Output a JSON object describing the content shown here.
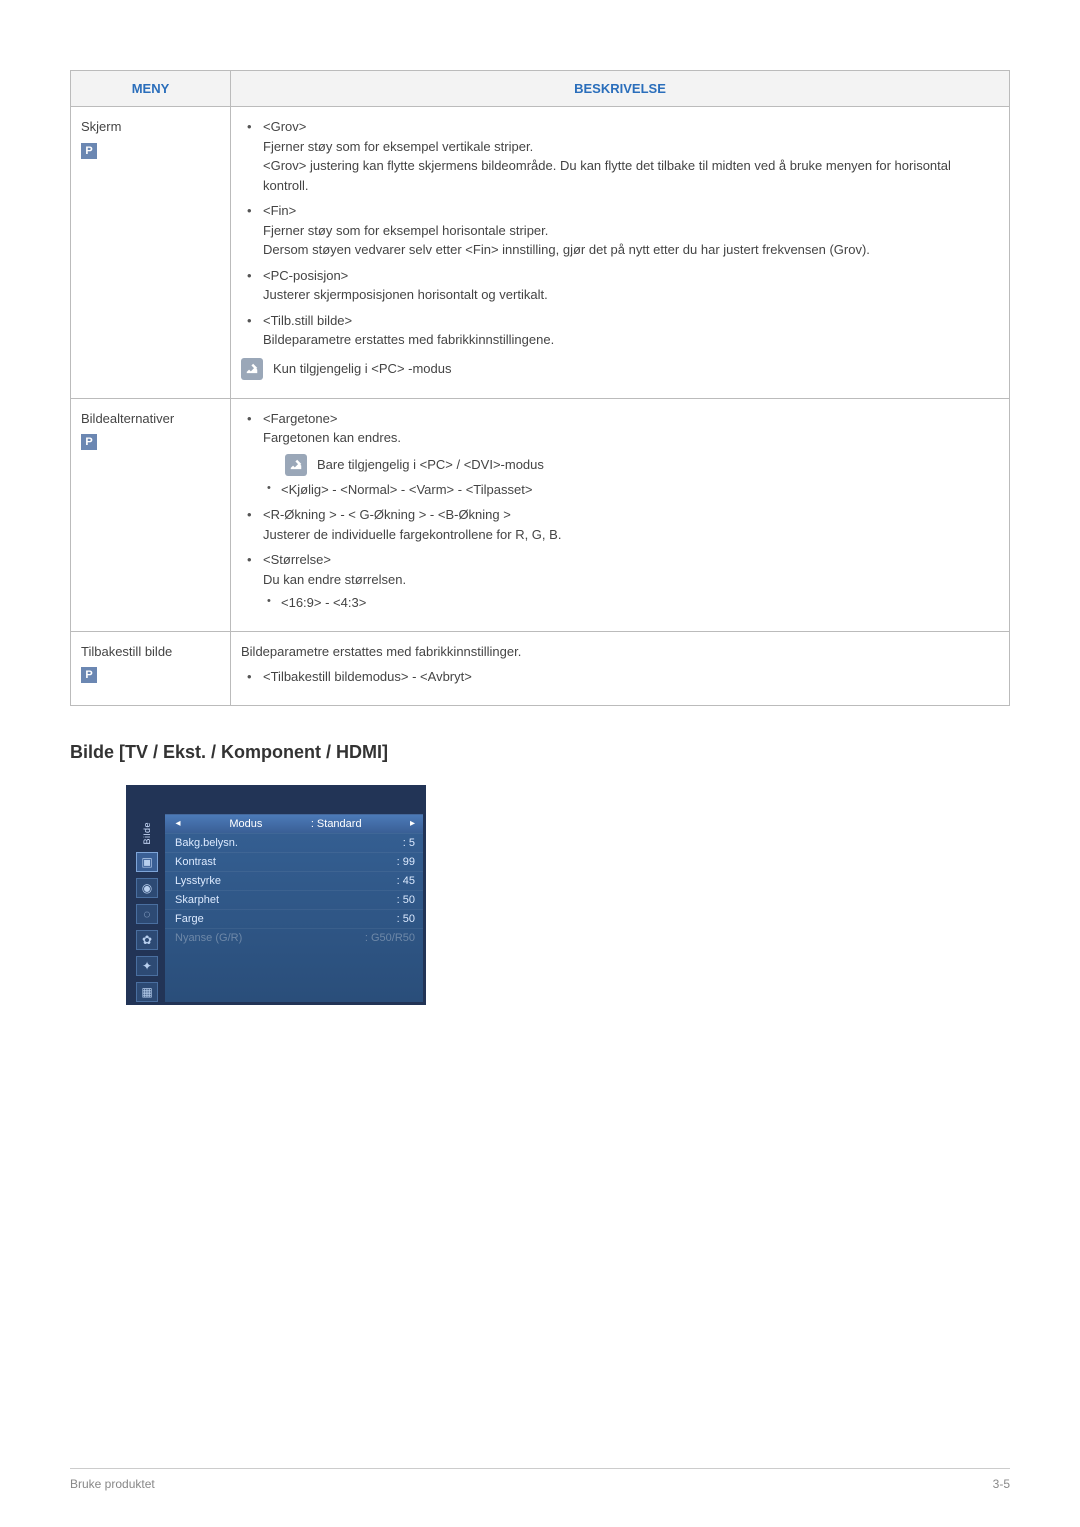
{
  "table": {
    "headers": {
      "menu": "MENY",
      "desc": "BESKRIVELSE"
    },
    "rows": [
      {
        "menu_label": "Skjerm",
        "p_badge": "P",
        "items": [
          {
            "title": "<Grov>",
            "lines": [
              "Fjerner støy som for eksempel vertikale striper.",
              "<Grov> justering kan flytte skjermens bildeområde. Du kan flytte det tilbake til midten ved å bruke menyen for horisontal kontroll."
            ]
          },
          {
            "title": "<Fin>",
            "lines": [
              "Fjerner støy som for eksempel horisontale striper.",
              "Dersom støyen vedvarer selv etter <Fin> innstilling, gjør det på nytt etter du har justert frekvensen (Grov)."
            ]
          },
          {
            "title": "<PC-posisjon>",
            "lines": [
              "Justerer skjermposisjonen horisontalt og vertikalt."
            ]
          },
          {
            "title": "<Tilb.still bilde>",
            "lines": [
              "Bildeparametre erstattes med fabrikkinnstillingene."
            ]
          }
        ],
        "note": "Kun tilgjengelig i <PC> -modus"
      },
      {
        "menu_label": "Bildealternativer",
        "p_badge": "P",
        "items_a": {
          "title": "<Fargetone>",
          "line": "Fargetonen kan endres."
        },
        "note_indent": "Bare tilgjengelig i <PC> / <DVI>-modus",
        "sub_a": "<Kjølig> - <Normal> - <Varm> - <Tilpasset>",
        "item_b": {
          "title": "<R-Økning > - < G-Økning > - <B-Økning >",
          "line": "Justerer de individuelle fargekontrollene for R, G, B."
        },
        "item_c": {
          "title": "<Størrelse>",
          "line": "Du kan endre størrelsen.",
          "sub": "<16:9> - <4:3>"
        }
      },
      {
        "menu_label": "Tilbakestill bilde",
        "p_badge": "P",
        "intro": "Bildeparametre erstattes med fabrikkinnstillinger.",
        "item": "<Tilbakestill bildemodus> - <Avbryt>"
      }
    ]
  },
  "section_heading": "Bilde [TV / Ekst. / Komponent / HDMI]",
  "osd": {
    "side_label": "Bilde",
    "rows": [
      {
        "label": "Modus",
        "value": ": Standard",
        "selected": true,
        "arrows": true
      },
      {
        "label": "Bakg.belysn.",
        "value": ": 5"
      },
      {
        "label": "Kontrast",
        "value": ": 99"
      },
      {
        "label": "Lysstyrke",
        "value": ": 45"
      },
      {
        "label": "Skarphet",
        "value": ": 50"
      },
      {
        "label": "Farge",
        "value": ": 50"
      },
      {
        "label": "Nyanse (G/R)",
        "value": ": G50/R50",
        "disabled": true
      }
    ]
  },
  "footer": {
    "left": "Bruke produktet",
    "right": "3-5"
  }
}
